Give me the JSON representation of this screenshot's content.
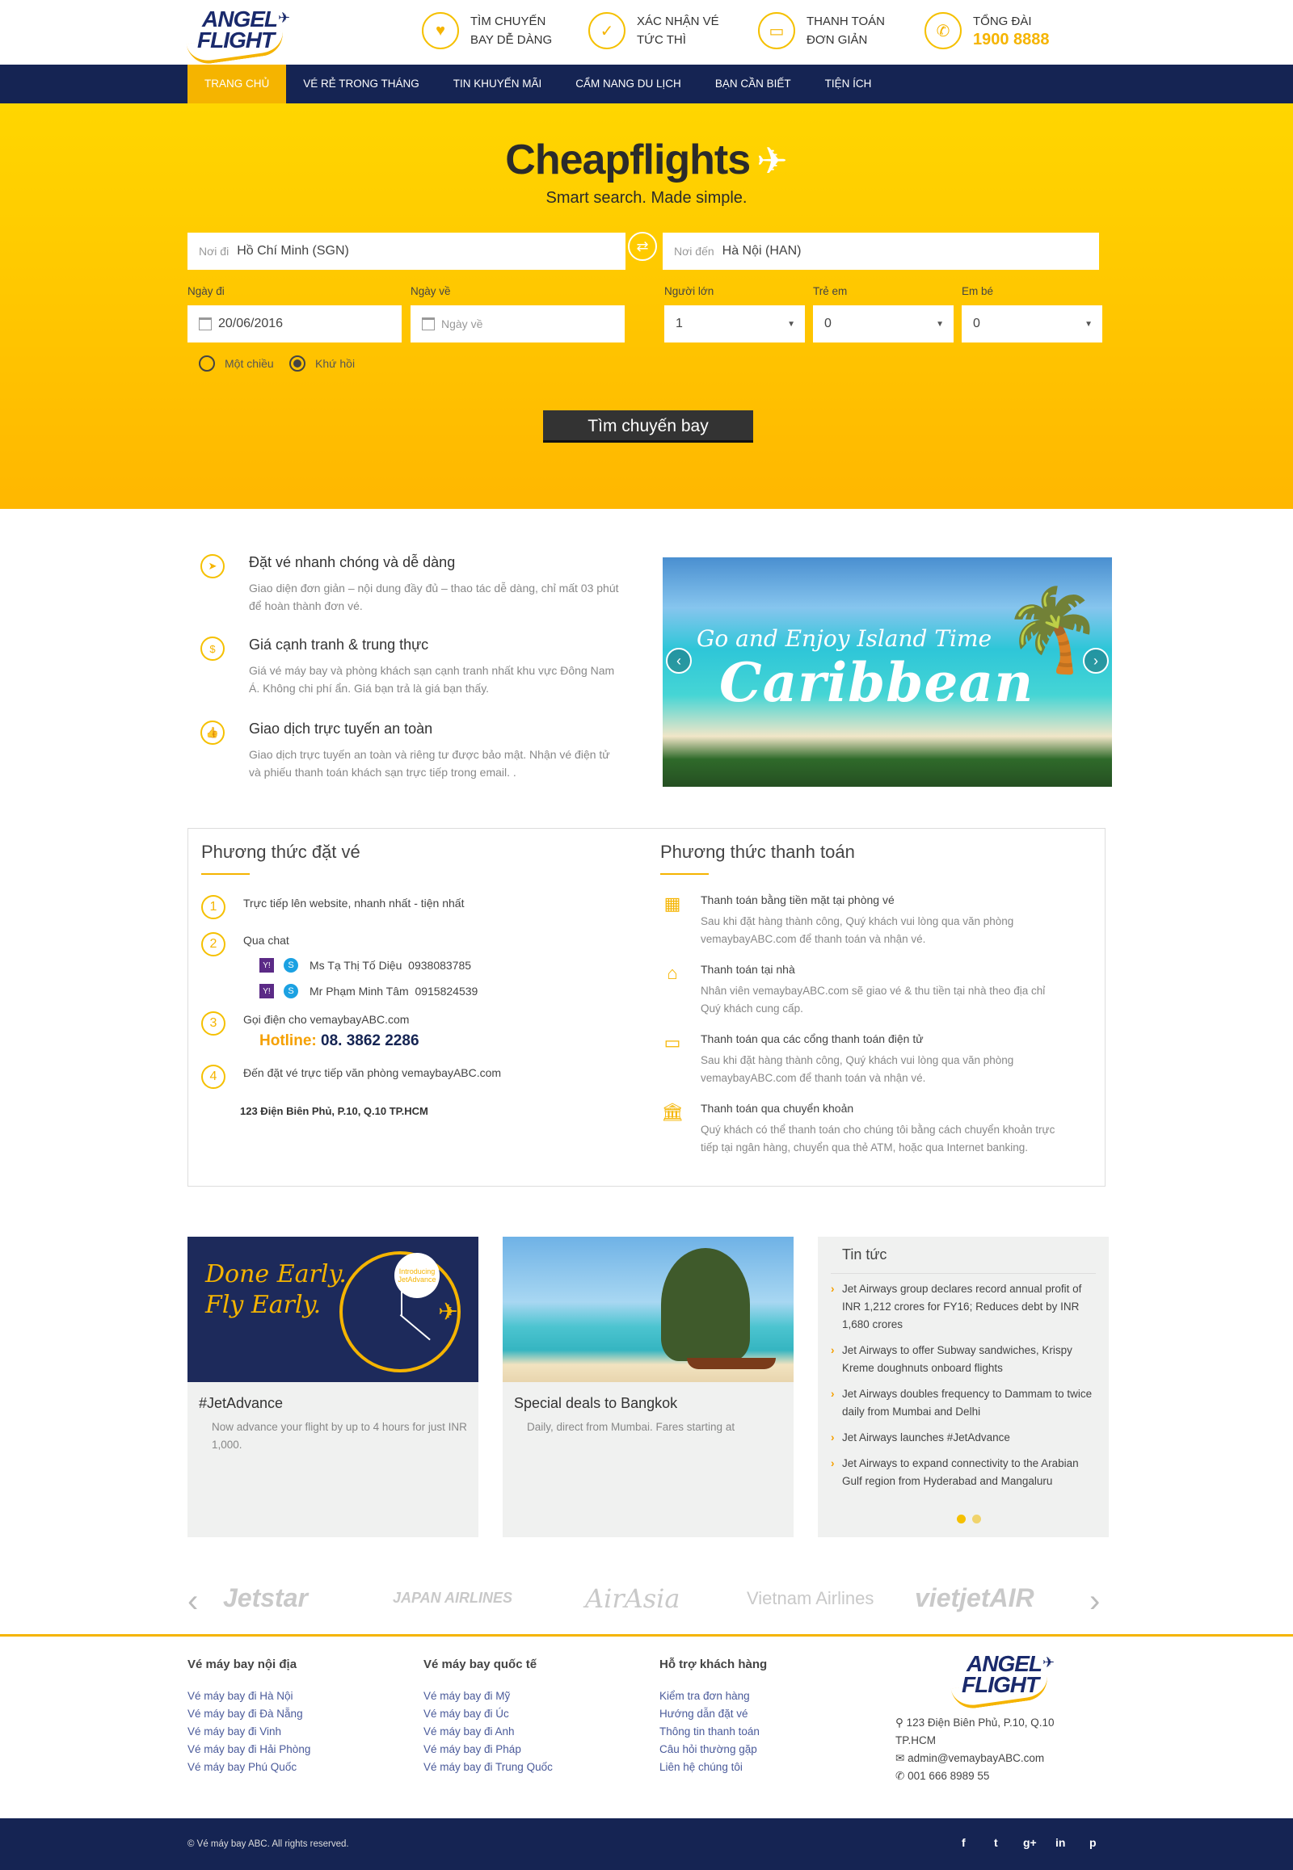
{
  "header": {
    "logo_line1": "ANGEL",
    "logo_line2": "FLIGHT",
    "features": [
      {
        "icon": "heart-icon",
        "line1": "TÌM CHUYẾN",
        "line2": "BAY DỄ DÀNG"
      },
      {
        "icon": "check-icon",
        "line1": "XÁC NHẬN VÉ",
        "line2": "TỨC THÌ"
      },
      {
        "icon": "card-icon",
        "line1": "THANH TOÁN",
        "line2": "ĐƠN GIẢN"
      },
      {
        "icon": "phone-icon",
        "line1": "TỔNG ĐÀI",
        "line2": "1900 8888"
      }
    ]
  },
  "nav": {
    "items": [
      "TRANG CHỦ",
      "VÉ RẺ TRONG THÁNG",
      "TIN KHUYẾN MÃI",
      "CẨM NANG DU LỊCH",
      "BẠN CẦN BIẾT",
      "TIỆN ÍCH"
    ],
    "active": "TRANG CHỦ"
  },
  "hero": {
    "brand": "Cheapflights",
    "tagline": "Smart search. Made simple.",
    "from_placeholder": "Nơi đi",
    "from_value": "Hồ Chí Minh (SGN)",
    "to_placeholder": "Nơi đến",
    "to_value": "Hà Nội (HAN)",
    "depart_label": "Ngày đi",
    "depart_value": "20/06/2016",
    "return_label": "Ngày về",
    "return_placeholder": "Ngày về",
    "adults_label": "Người lớn",
    "adults_value": "1",
    "children_label": "Trẻ em",
    "children_value": "0",
    "infants_label": "Em bé",
    "infants_value": "0",
    "oneway_label": "Một chiều",
    "roundtrip_label": "Khứ hồi",
    "selected_trip": "Khứ hồi",
    "search_button": "Tìm chuyến bay"
  },
  "benefits": [
    {
      "icon": "paper-plane-icon",
      "title": "Đặt vé nhanh chóng và dễ dàng",
      "text": "Giao diện đơn giản – nội dung đầy đủ – thao tác dễ dàng, chỉ mất 03 phút để hoàn thành đơn vé."
    },
    {
      "icon": "dollar-icon",
      "title": "Giá cạnh tranh & trung thực",
      "text": "Giá vé máy bay và phòng khách sạn cạnh tranh nhất khu vực Đông Nam Á. Không chi phí ẩn. Giá bạn trả là giá bạn thấy."
    },
    {
      "icon": "thumbs-up-icon",
      "title": "Giao dịch trực tuyến an toàn",
      "text": "Giao dịch trực tuyến an toàn và riêng tư được bảo mật. Nhận vé điện tử và phiếu thanh toán khách sạn trực tiếp trong email. ."
    }
  ],
  "slider": {
    "caption1": "Go and Enjoy Island Time",
    "caption2": "Caribbean"
  },
  "booking": {
    "title": "Phương thức đặt vé",
    "steps": [
      {
        "n": "1",
        "text": "Trực tiếp lên website, nhanh nhất - tiện nhất"
      },
      {
        "n": "2",
        "text": "Qua chat"
      },
      {
        "n": "3",
        "text": "Gọi điện cho vemaybayABC.com"
      },
      {
        "n": "4",
        "text": "Đến đặt vé trực tiếp văn phòng vemaybayABC.com"
      }
    ],
    "chats": [
      {
        "name": "Ms Tạ Thị Tố Diệu",
        "phone": "0938083785"
      },
      {
        "name": "Mr Phạm Minh Tâm",
        "phone": "0915824539"
      }
    ],
    "hotline_label": "Hotline:",
    "hotline_number": "08. 3862 2286",
    "address": "123 Điện Biên Phủ, P.10, Q.10 TP.HCM"
  },
  "payment": {
    "title": "Phương thức thanh toán",
    "methods": [
      {
        "icon": "building-icon",
        "title": "Thanh toán bằng tiền mặt tại phòng vé",
        "text": "Sau khi đặt hàng thành công, Quý khách vui lòng qua văn phòng vemaybayABC.com để thanh toán và nhận vé."
      },
      {
        "icon": "home-icon",
        "title": "Thanh toán tại nhà",
        "text": "Nhân viên vemaybayABC.com sẽ giao vé & thu tiền tại nhà theo địa chỉ Quý khách cung cấp."
      },
      {
        "icon": "wallet-icon",
        "title": "Thanh toán qua các cổng thanh toán điện tử",
        "text": "Sau khi đặt hàng thành công, Quý khách vui lòng qua văn phòng vemaybayABC.com để thanh toán và nhận vé."
      },
      {
        "icon": "bank-icon",
        "title": "Thanh toán qua chuyển khoản",
        "text": "Quý khách có thể thanh toán cho chúng tôi bằng cách chuyển khoản trực tiếp tại ngân hàng, chuyển qua thẻ ATM, hoặc qua Internet banking."
      }
    ]
  },
  "cards": [
    {
      "img_line1": "Done Early.",
      "img_line2": "Fly Early.",
      "badge": "Introducing JetAdvance",
      "title": "#JetAdvance",
      "text": "Now advance your flight by up to 4 hours for just INR 1,000."
    },
    {
      "title": "Special deals to Bangkok",
      "text": "Daily, direct from Mumbai. Fares starting at"
    }
  ],
  "news": {
    "title": "Tin tức",
    "items": [
      "Jet Airways group declares record annual profit of INR 1,212 crores for FY16; Reduces debt by INR 1,680 crores",
      "Jet Airways to offer Subway sandwiches, Krispy Kreme doughnuts onboard flights",
      "Jet Airways doubles frequency to Dammam to twice daily from Mumbai and Delhi",
      "Jet Airways launches #JetAdvance",
      "Jet Airways to expand connectivity to the Arabian Gulf region from Hyderabad and Mangaluru"
    ]
  },
  "airlines": [
    "Jetstar",
    "JAPAN AIRLINES",
    "AirAsia",
    "Vietnam Airlines",
    "vietjetAIR"
  ],
  "footer": {
    "cols": [
      {
        "title": "Vé máy bay nội địa",
        "links": [
          "Vé máy bay đi Hà Nội",
          "Vé máy bay đi Đà Nẵng",
          "Vé máy bay đi Vinh",
          "Vé máy bay đi Hải Phòng",
          "Vé máy bay Phú Quốc"
        ]
      },
      {
        "title": "Vé máy bay quốc tế",
        "links": [
          "Vé máy bay đi Mỹ",
          "Vé máy bay đi Úc",
          "Vé máy bay đi Anh",
          "Vé máy bay đi Pháp",
          "Vé máy bay đi Trung Quốc"
        ]
      },
      {
        "title": "Hỗ trợ khách hàng",
        "links": [
          "Kiểm tra đơn hàng",
          "Hướng dẫn đặt vé",
          "Thông tin thanh toán",
          "Câu hỏi thường gặp",
          "Liên hệ chúng tôi"
        ]
      }
    ],
    "address": "123 Điện Biên Phủ, P.10, Q.10 TP.HCM",
    "email": "admin@vemaybayABC.com",
    "phone": "001 666 8989 55",
    "copyright": "© Vé máy bay ABC. All rights reserved.",
    "social": [
      "f",
      "t",
      "g+",
      "in",
      "p"
    ]
  },
  "colors": {
    "accent": "#f5b400",
    "navy": "#152453"
  }
}
